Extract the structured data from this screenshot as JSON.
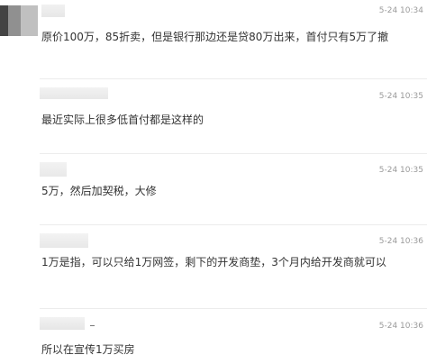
{
  "comments": [
    {
      "time": "5-24 10:34",
      "text": "原价100万，85折卖，但是银行那边还是贷80万出来，首付只有5万了撤"
    },
    {
      "time": "5-24 10:35",
      "text": "最近实际上很多低首付都是这样的"
    },
    {
      "time": "5-24 10:35",
      "text": "5万，然后加契税，大修"
    },
    {
      "time": "5-24 10:36",
      "text": "1万是指，可以只给1万网签，剩下的开发商垫，3个月内给开发商就可以"
    },
    {
      "time": "5-24 10:36",
      "text": "所以在宣传1万买房"
    }
  ]
}
